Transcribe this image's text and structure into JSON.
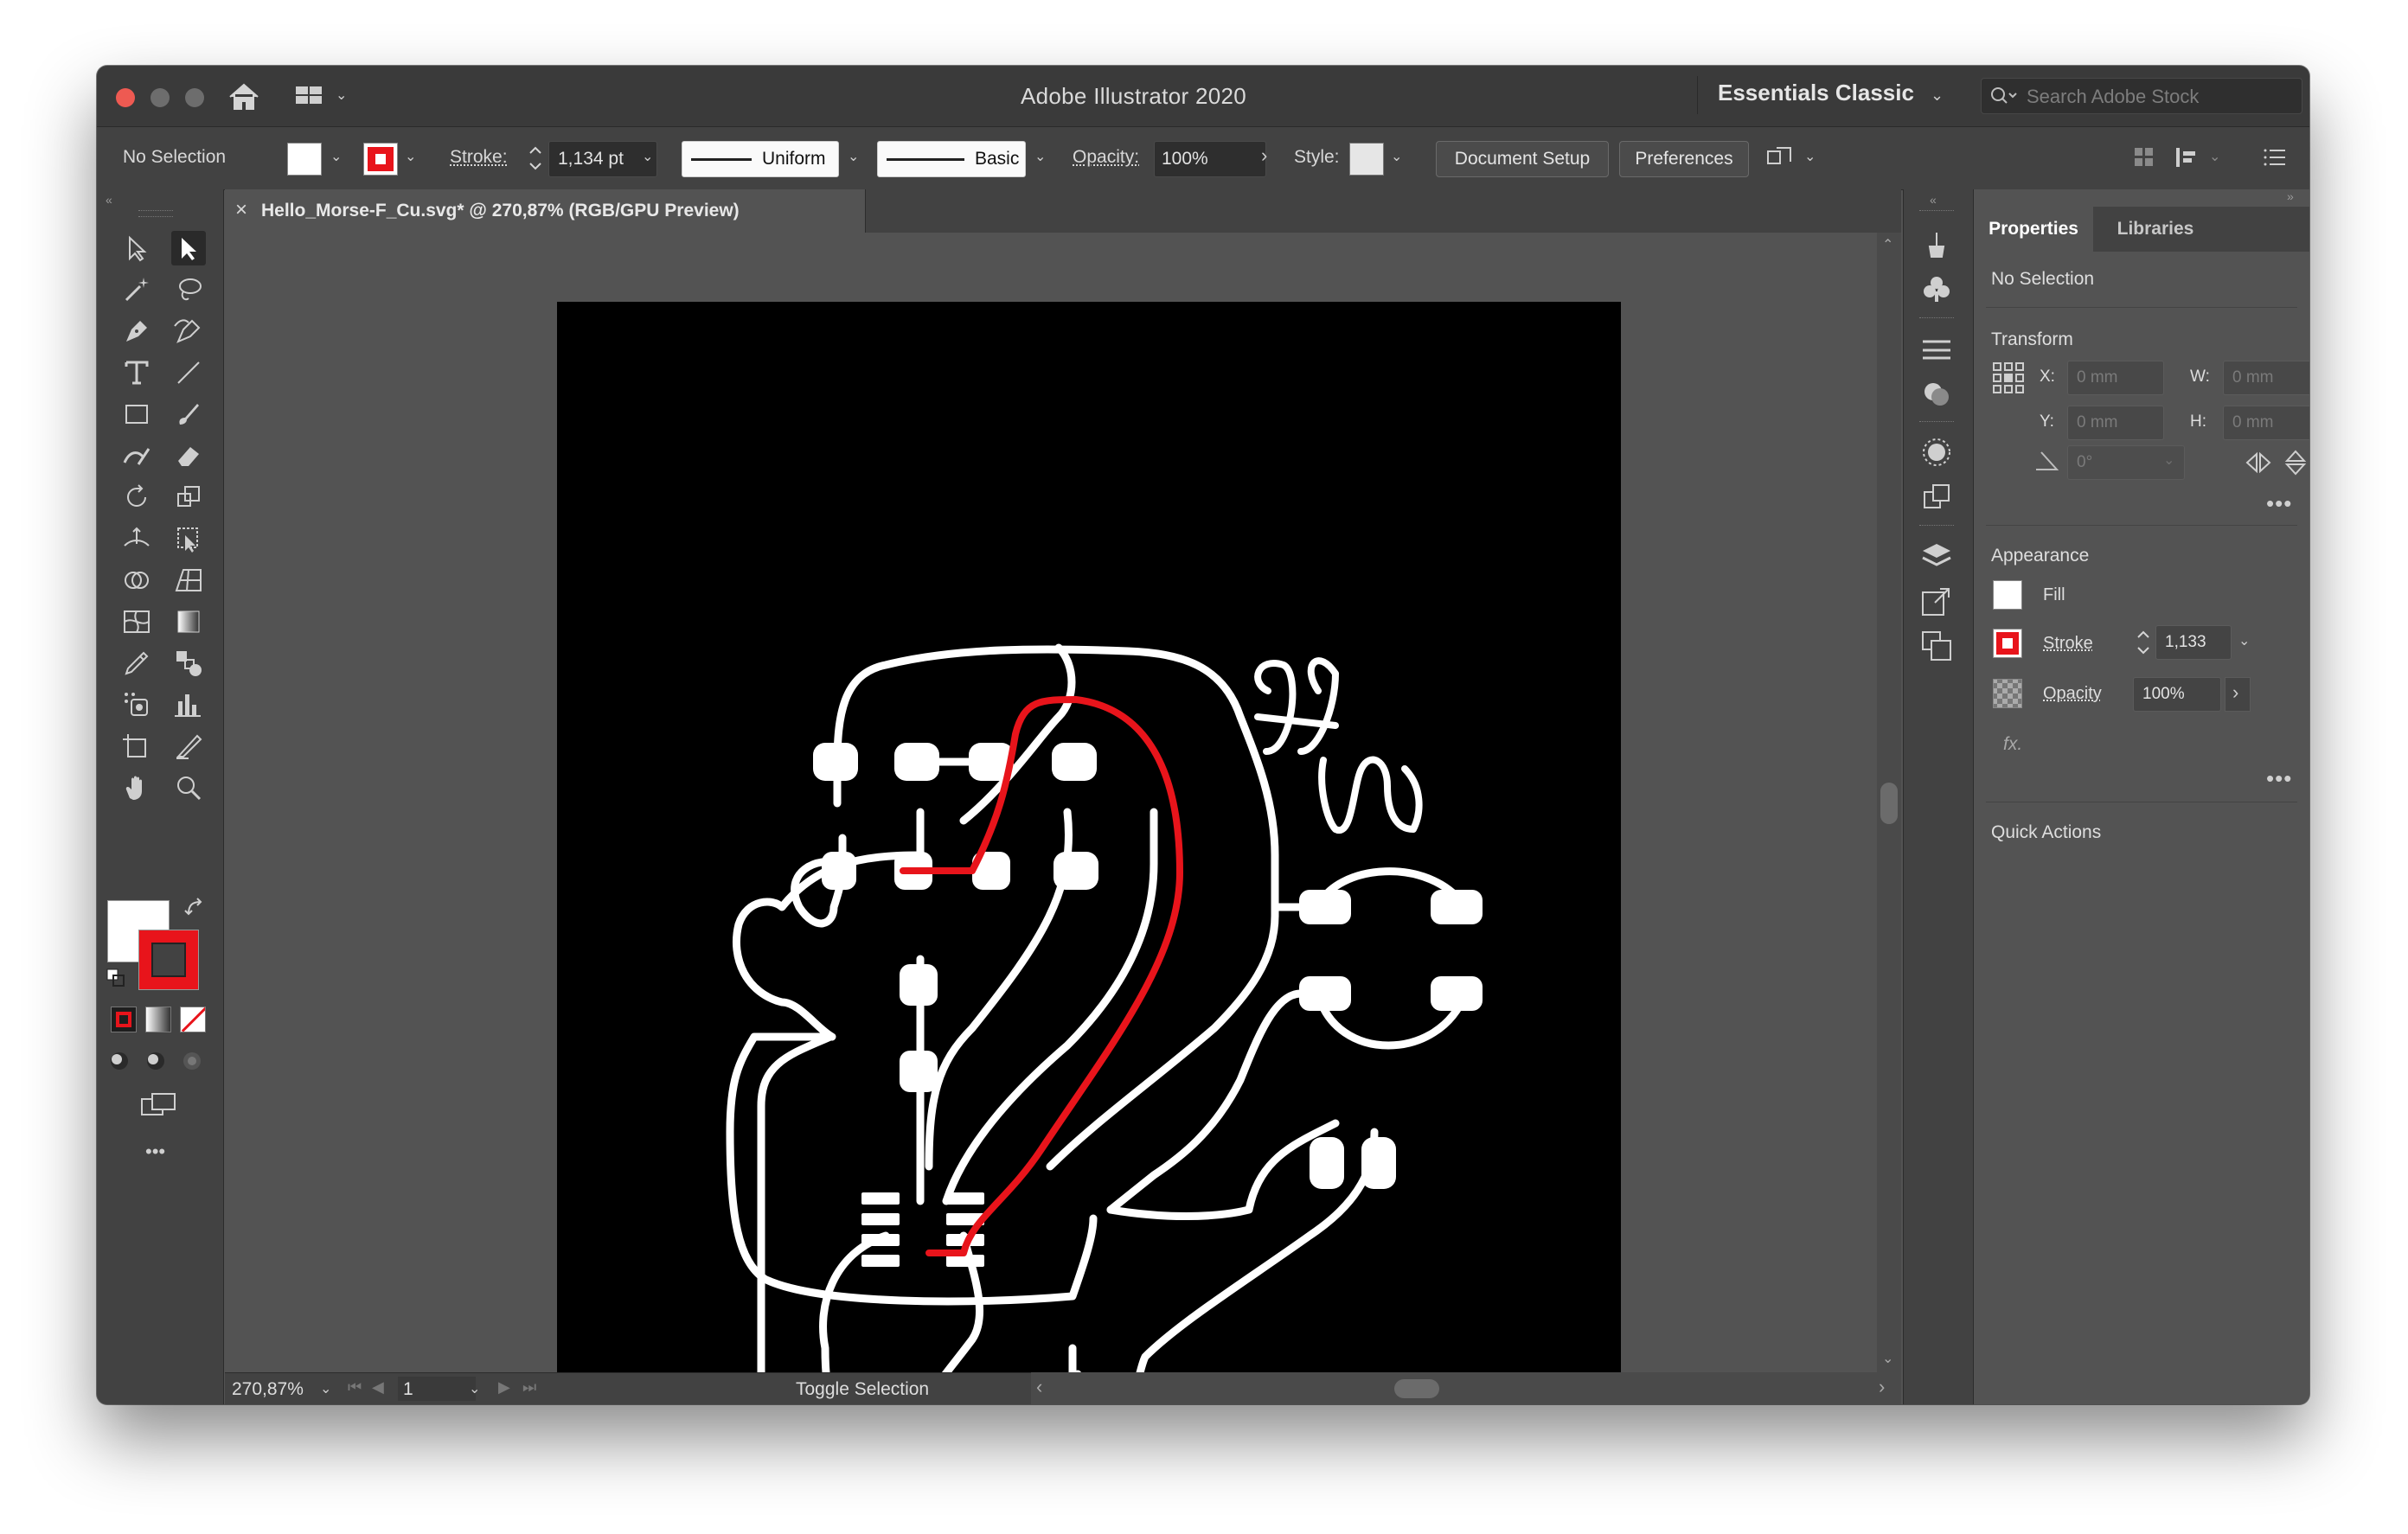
{
  "window": {
    "title": "Adobe Illustrator 2020",
    "workspace": "Essentials Classic",
    "search_placeholder": "Search Adobe Stock"
  },
  "controlbar": {
    "selection": "No Selection",
    "stroke_label": "Stroke:",
    "stroke_value": "1,134 pt",
    "profile": "Uniform",
    "brush": "Basic",
    "opacity_label": "Opacity:",
    "opacity_value": "100%",
    "style_label": "Style:",
    "document_setup": "Document Setup",
    "preferences": "Preferences"
  },
  "document_tab": {
    "close": "×",
    "label": "Hello_Morse-F_Cu.svg* @ 270,87% (RGB/GPU Preview)"
  },
  "colors": {
    "accent_red": "#e8141b",
    "trace_white": "#ffffff",
    "artboard": "#000000",
    "ui_dark": "#424242",
    "ui_mid": "#535353"
  },
  "toolbar": {
    "tools": [
      "direct-selection-icon",
      "selection-icon",
      "magic-wand-icon",
      "lasso-icon",
      "pen-icon",
      "curvature-icon",
      "type-icon",
      "line-segment-icon",
      "rectangle-icon",
      "paintbrush-icon",
      "shaper-icon",
      "eraser-icon",
      "rotate-icon",
      "scale-icon",
      "width-icon",
      "free-transform-icon",
      "shape-builder-icon",
      "perspective-grid-icon",
      "mesh-icon",
      "gradient-icon",
      "eyedropper-icon",
      "blend-icon",
      "symbol-sprayer-icon",
      "column-graph-icon",
      "artboard-icon",
      "slice-icon",
      "hand-icon",
      "zoom-icon"
    ],
    "more": "•••"
  },
  "properties": {
    "tabs": [
      "Properties",
      "Libraries"
    ],
    "selection": "No Selection",
    "transform": {
      "title": "Transform",
      "x_label": "X:",
      "x_value": "0 mm",
      "y_label": "Y:",
      "y_value": "0 mm",
      "w_label": "W:",
      "w_value": "0 mm",
      "h_label": "H:",
      "h_value": "0 mm",
      "angle_value": "0°"
    },
    "appearance": {
      "title": "Appearance",
      "fill_label": "Fill",
      "stroke_label": "Stroke",
      "stroke_value": "1,133",
      "opacity_label": "Opacity",
      "opacity_value": "100%",
      "fx": "fx."
    },
    "quick_actions": "Quick Actions",
    "more": "•••"
  },
  "statusbar": {
    "zoom": "270,87%",
    "artboard_number": "1",
    "status": "Toggle Selection"
  }
}
